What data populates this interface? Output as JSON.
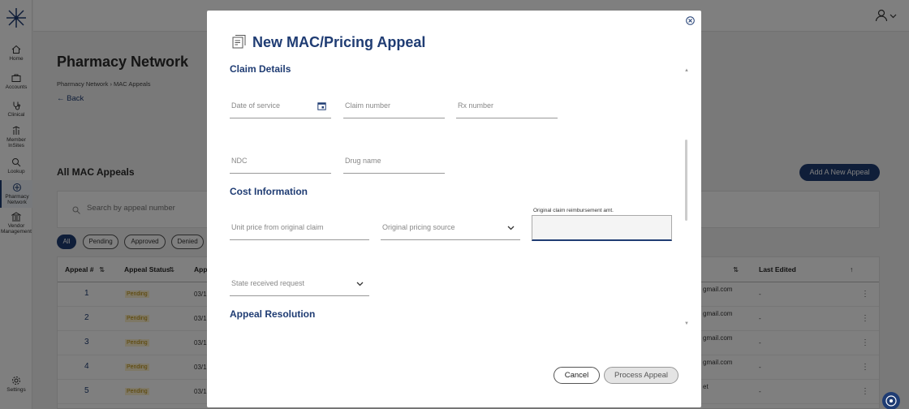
{
  "sidebar": {
    "items": [
      {
        "label": "Home",
        "icon": "home-icon"
      },
      {
        "label": "Accounts",
        "icon": "briefcase-icon"
      },
      {
        "label": "Clinical",
        "icon": "stethoscope-icon"
      },
      {
        "label": "Member InSites",
        "icon": "member-insites-icon"
      },
      {
        "label": "Lookup",
        "icon": "search-icon"
      },
      {
        "label": "Pharmacy Network",
        "icon": "pharmacy-network-icon"
      },
      {
        "label": "Vendor Management",
        "icon": "vendor-icon"
      },
      {
        "label": "Settings",
        "icon": "gear-icon"
      }
    ]
  },
  "page": {
    "title": "Pharmacy Network",
    "breadcrumb": [
      "Pharmacy Network",
      "MAC Appeals"
    ],
    "back_label": "Back",
    "section_title": "All MAC Appeals",
    "add_button": "Add A New Appeal",
    "search_placeholder": "Search by appeal number",
    "filters": [
      "All",
      "Pending",
      "Approved",
      "Denied"
    ],
    "columns": [
      "Appeal #",
      "Appeal Status",
      "Appe",
      "Last Edited"
    ],
    "rows": [
      {
        "num": "1",
        "status": "Pending",
        "date": "03/1",
        "email": "gmail.com",
        "edited": "-"
      },
      {
        "num": "2",
        "status": "Pending",
        "date": "03/1",
        "email": "gmail.com",
        "edited": "-"
      },
      {
        "num": "3",
        "status": "Pending",
        "date": "03/1",
        "email": "gmail.com",
        "edited": "-"
      },
      {
        "num": "4",
        "status": "Pending",
        "date": "03/1",
        "email": "gmail.com",
        "edited": "-"
      },
      {
        "num": "5",
        "status": "Pending",
        "date": "03/1",
        "email": "et",
        "edited": "-"
      }
    ]
  },
  "modal": {
    "title": "New MAC/Pricing Appeal",
    "sections": {
      "claim": "Claim Details",
      "cost": "Cost Information",
      "resolution": "Appeal Resolution"
    },
    "fields": {
      "date_of_service": "Date of service",
      "claim_number": "Claim number",
      "rx_number": "Rx number",
      "ndc": "NDC",
      "drug_name": "Drug name",
      "unit_price": "Unit price from original claim",
      "pricing_source": "Original pricing source",
      "reimbursement_label": "Original claim reimbursement amt.",
      "state_received": "State received request"
    },
    "cancel": "Cancel",
    "process": "Process Appeal"
  },
  "colors": {
    "brand": "#1f3c73",
    "pending_badge": "#fdf0cc"
  }
}
